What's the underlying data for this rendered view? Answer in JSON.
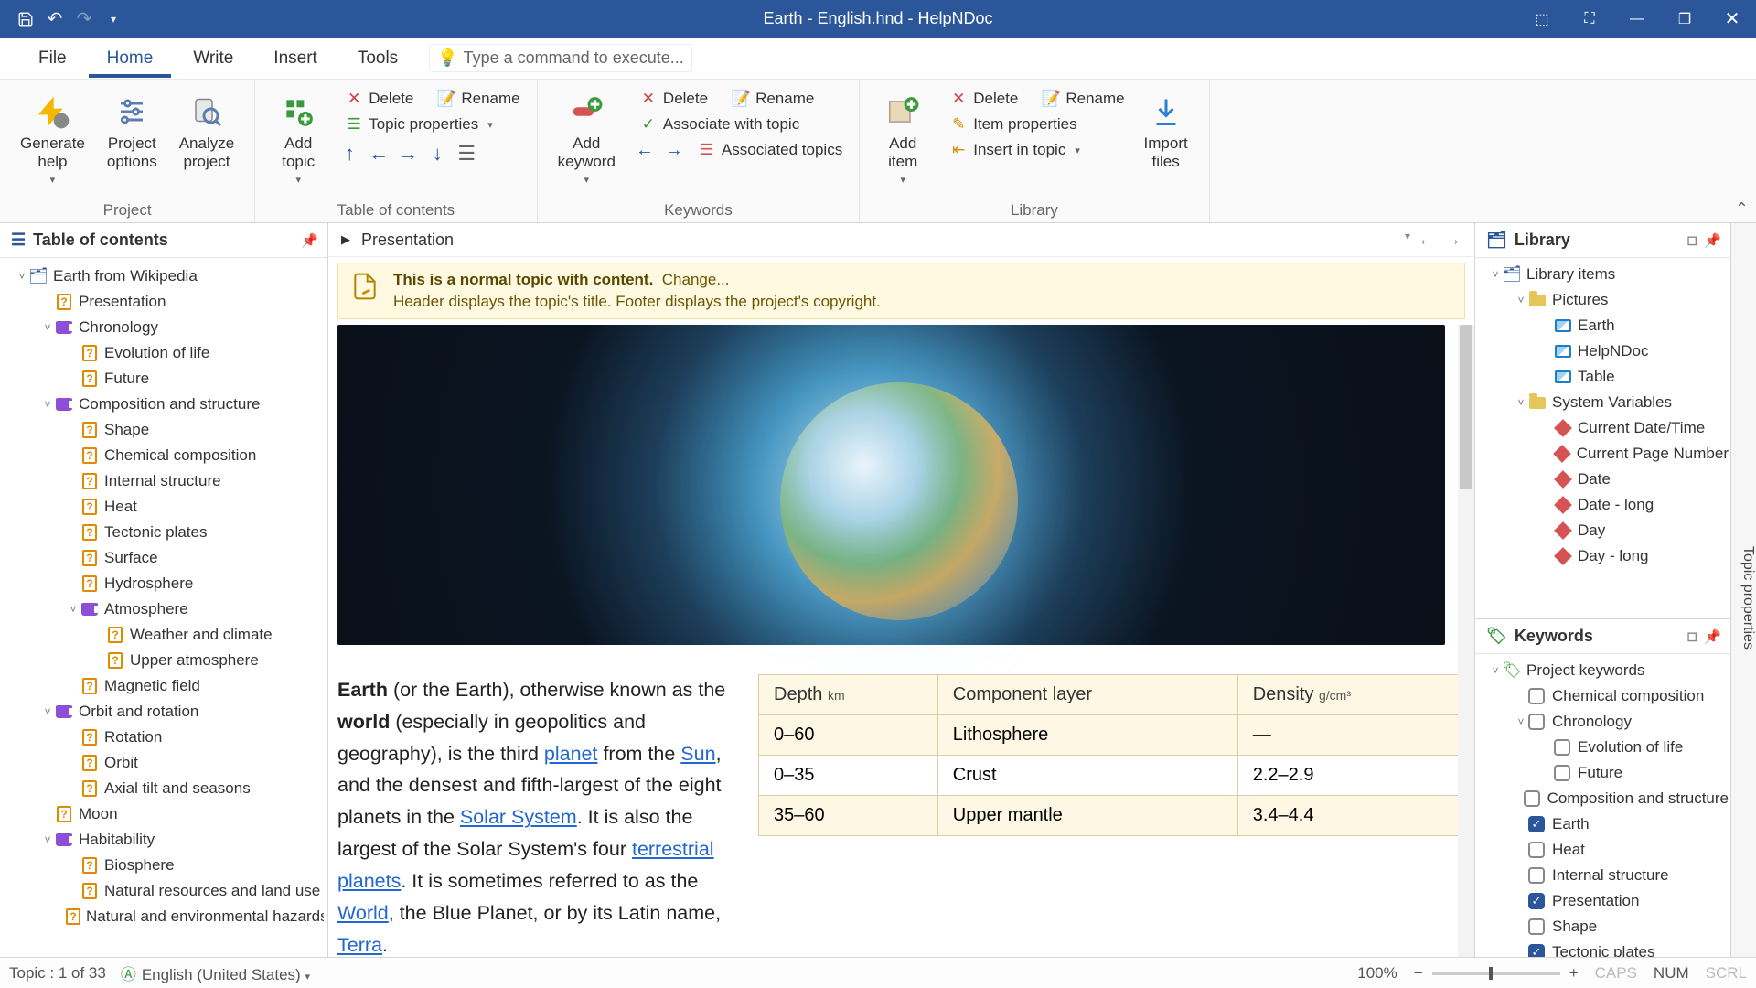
{
  "title": "Earth - English.hnd - HelpNDoc",
  "tabs": [
    "File",
    "Home",
    "Write",
    "Insert",
    "Tools"
  ],
  "active_tab": 1,
  "tell_me_placeholder": "Type a command to execute...",
  "ribbon": {
    "project": {
      "label": "Project",
      "generate": "Generate\nhelp",
      "options": "Project\noptions",
      "analyze": "Analyze\nproject"
    },
    "toc": {
      "label": "Table of contents",
      "add_topic": "Add\ntopic",
      "delete": "Delete",
      "rename": "Rename",
      "props": "Topic properties"
    },
    "keywords": {
      "label": "Keywords",
      "add": "Add\nkeyword",
      "delete": "Delete",
      "rename": "Rename",
      "assoc": "Associate with topic",
      "assoc_topics": "Associated topics"
    },
    "library": {
      "label": "Library",
      "add": "Add\nitem",
      "delete": "Delete",
      "rename": "Rename",
      "props": "Item properties",
      "insert": "Insert in topic",
      "import": "Import\nfiles"
    }
  },
  "toc_panel": {
    "title": "Table of contents",
    "nodes": [
      {
        "l": 1,
        "tw": "v",
        "ico": "root",
        "t": "Earth from Wikipedia"
      },
      {
        "l": 2,
        "tw": "",
        "ico": "q",
        "t": "Presentation"
      },
      {
        "l": 2,
        "tw": "v",
        "ico": "book",
        "t": "Chronology"
      },
      {
        "l": 3,
        "tw": "",
        "ico": "q",
        "t": "Evolution of life"
      },
      {
        "l": 3,
        "tw": "",
        "ico": "q",
        "t": "Future"
      },
      {
        "l": 2,
        "tw": "v",
        "ico": "book",
        "t": "Composition and structure"
      },
      {
        "l": 3,
        "tw": "",
        "ico": "q",
        "t": "Shape"
      },
      {
        "l": 3,
        "tw": "",
        "ico": "q",
        "t": "Chemical composition"
      },
      {
        "l": 3,
        "tw": "",
        "ico": "q",
        "t": "Internal structure"
      },
      {
        "l": 3,
        "tw": "",
        "ico": "q",
        "t": "Heat"
      },
      {
        "l": 3,
        "tw": "",
        "ico": "q",
        "t": "Tectonic plates"
      },
      {
        "l": 3,
        "tw": "",
        "ico": "q",
        "t": "Surface"
      },
      {
        "l": 3,
        "tw": "",
        "ico": "q",
        "t": "Hydrosphere"
      },
      {
        "l": 3,
        "tw": "v",
        "ico": "book",
        "t": "Atmosphere"
      },
      {
        "l": 4,
        "tw": "",
        "ico": "q",
        "t": "Weather and climate"
      },
      {
        "l": 4,
        "tw": "",
        "ico": "q",
        "t": "Upper atmosphere"
      },
      {
        "l": 3,
        "tw": "",
        "ico": "q",
        "t": "Magnetic field"
      },
      {
        "l": 2,
        "tw": "v",
        "ico": "book",
        "t": "Orbit and rotation"
      },
      {
        "l": 3,
        "tw": "",
        "ico": "q",
        "t": "Rotation"
      },
      {
        "l": 3,
        "tw": "",
        "ico": "q",
        "t": "Orbit"
      },
      {
        "l": 3,
        "tw": "",
        "ico": "q",
        "t": "Axial tilt and seasons"
      },
      {
        "l": 2,
        "tw": "",
        "ico": "q",
        "t": "Moon"
      },
      {
        "l": 2,
        "tw": "v",
        "ico": "book",
        "t": "Habitability"
      },
      {
        "l": 3,
        "tw": "",
        "ico": "q",
        "t": "Biosphere"
      },
      {
        "l": 3,
        "tw": "",
        "ico": "q",
        "t": "Natural resources and land use"
      },
      {
        "l": 3,
        "tw": "",
        "ico": "q",
        "t": "Natural and environmental hazards"
      }
    ]
  },
  "breadcrumb": "Presentation",
  "info": {
    "l1a": "This is a normal topic with content.",
    "l1b": "Change...",
    "l2": "Header displays the topic's title.  Footer displays the project's copyright."
  },
  "prose": {
    "p1_a": "Earth",
    "p1_b": " (or the Earth), otherwise known as the ",
    "p1_c": "world",
    "p1_d": " (especially in geopolitics and geography), is the third ",
    "p1_e": "planet",
    "p1_f": " from the ",
    "p1_g": "Sun",
    "p1_h": ", and the densest and fifth-largest of the eight planets in the ",
    "p1_i": "Solar System",
    "p1_j": ". It is also the largest of the Solar System's four ",
    "p1_k": "terrestrial planets",
    "p1_l": ". It is sometimes referred to as the ",
    "p1_m": "World",
    "p1_n": ", the Blue Planet, or by its Latin name, ",
    "p1_o": "Terra",
    "p1_p": "."
  },
  "table": {
    "h1": "Depth",
    "h1u": "km",
    "h2": "Component layer",
    "h3": "Density",
    "h3u": "g/cm³",
    "rows": [
      [
        "0–60",
        "Lithosphere",
        "—"
      ],
      [
        "0–35",
        "Crust",
        "2.2–2.9"
      ],
      [
        "35–60",
        "Upper mantle",
        "3.4–4.4"
      ]
    ]
  },
  "library": {
    "title": "Library",
    "nodes": [
      {
        "l": 1,
        "tw": "v",
        "ico": "root",
        "t": "Library items"
      },
      {
        "l": 2,
        "tw": "v",
        "ico": "folder",
        "t": "Pictures"
      },
      {
        "l": 3,
        "tw": "",
        "ico": "pic",
        "t": "Earth"
      },
      {
        "l": 3,
        "tw": "",
        "ico": "pic",
        "t": "HelpNDoc"
      },
      {
        "l": 3,
        "tw": "",
        "ico": "pic",
        "t": "Table"
      },
      {
        "l": 2,
        "tw": "v",
        "ico": "folder",
        "t": "System Variables"
      },
      {
        "l": 3,
        "tw": "",
        "ico": "var",
        "t": "Current Date/Time"
      },
      {
        "l": 3,
        "tw": "",
        "ico": "var",
        "t": "Current Page Number"
      },
      {
        "l": 3,
        "tw": "",
        "ico": "var",
        "t": "Date"
      },
      {
        "l": 3,
        "tw": "",
        "ico": "var",
        "t": "Date - long"
      },
      {
        "l": 3,
        "tw": "",
        "ico": "var",
        "t": "Day"
      },
      {
        "l": 3,
        "tw": "",
        "ico": "var",
        "t": "Day - long"
      }
    ]
  },
  "keywords": {
    "title": "Keywords",
    "root": "Project keywords",
    "items": [
      {
        "l": 2,
        "chk": false,
        "t": "Chemical composition"
      },
      {
        "l": 2,
        "chk": false,
        "t": "Chronology",
        "tw": "v"
      },
      {
        "l": 3,
        "chk": false,
        "t": "Evolution of life"
      },
      {
        "l": 3,
        "chk": false,
        "t": "Future"
      },
      {
        "l": 2,
        "chk": false,
        "t": "Composition and structure"
      },
      {
        "l": 2,
        "chk": true,
        "t": "Earth"
      },
      {
        "l": 2,
        "chk": false,
        "t": "Heat"
      },
      {
        "l": 2,
        "chk": false,
        "t": "Internal structure"
      },
      {
        "l": 2,
        "chk": true,
        "t": "Presentation"
      },
      {
        "l": 2,
        "chk": false,
        "t": "Shape"
      },
      {
        "l": 2,
        "chk": true,
        "t": "Tectonic plates"
      }
    ]
  },
  "rightstrip": "Topic properties",
  "status": {
    "topic": "Topic : 1 of 33",
    "lang": "English (United States)",
    "zoom": "100%",
    "caps": "CAPS",
    "num": "NUM",
    "scrl": "SCRL"
  }
}
